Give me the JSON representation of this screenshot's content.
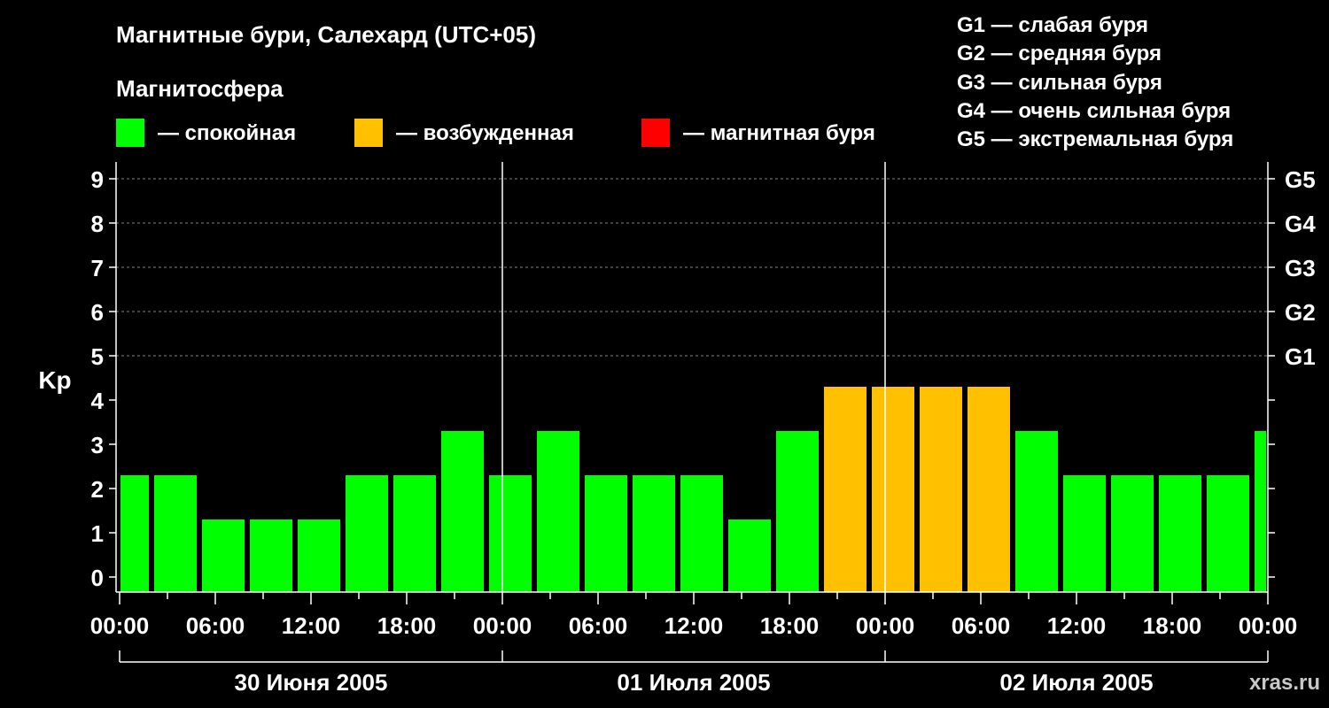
{
  "colors": {
    "background": "#000000",
    "quiet": "#00ff00",
    "excited": "#ffc000",
    "storm": "#ff0000",
    "axis": "#ffffff",
    "grid": "#808080"
  },
  "title": "Магнитные бури, Салехард (UTC+05)",
  "legend": {
    "heading": "Магнитосфера",
    "items": [
      {
        "key": "quiet",
        "label": "— спокойная",
        "color": "#00ff00"
      },
      {
        "key": "excited",
        "label": "— возбужденная",
        "color": "#ffc000"
      },
      {
        "key": "storm",
        "label": "— магнитная буря",
        "color": "#ff0000"
      }
    ]
  },
  "g_scale": [
    "G1 — слабая буря",
    "G2 — средняя буря",
    "G3 — сильная буря",
    "G4 — очень сильная буря",
    "G5 — экстремальная буря"
  ],
  "watermark": "xras.ru",
  "chart_data": {
    "type": "bar",
    "ylabel": "Kp",
    "ylim": [
      0,
      9
    ],
    "yticks": [
      0,
      1,
      2,
      3,
      4,
      5,
      6,
      7,
      8,
      9
    ],
    "right_ticks": [
      {
        "kp": 5,
        "label": "G1"
      },
      {
        "kp": 6,
        "label": "G2"
      },
      {
        "kp": 7,
        "label": "G3"
      },
      {
        "kp": 8,
        "label": "G4"
      },
      {
        "kp": 9,
        "label": "G5"
      }
    ],
    "grid": "dashed horizontal at Kp 5–9",
    "xlim_hours": [
      0,
      72
    ],
    "xtick_labels": [
      "00:00",
      "06:00",
      "12:00",
      "18:00",
      "00:00",
      "06:00",
      "12:00",
      "18:00",
      "00:00",
      "06:00",
      "12:00",
      "18:00",
      "00:00"
    ],
    "day_labels": [
      "30 Июня 2005",
      "01 Июля 2005",
      "02 Июля 2005"
    ],
    "bar_interval_hours": 3,
    "first_bar_start_hours": -1,
    "values": [
      2,
      2,
      1,
      1,
      1,
      2,
      2,
      3,
      2,
      3,
      2,
      2,
      2,
      1,
      3,
      4,
      4,
      4,
      4,
      3,
      2,
      2,
      2,
      2,
      3
    ],
    "categories": [
      "quiet",
      "quiet",
      "quiet",
      "quiet",
      "quiet",
      "quiet",
      "quiet",
      "quiet",
      "quiet",
      "quiet",
      "quiet",
      "quiet",
      "quiet",
      "quiet",
      "quiet",
      "excited",
      "excited",
      "excited",
      "excited",
      "quiet",
      "quiet",
      "quiet",
      "quiet",
      "quiet",
      "quiet"
    ]
  }
}
